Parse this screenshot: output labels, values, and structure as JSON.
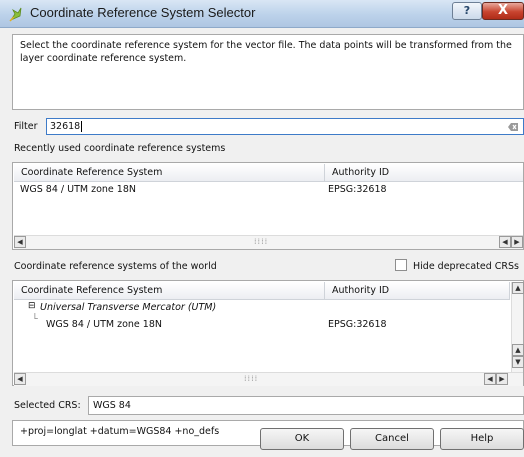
{
  "window": {
    "title": "Coordinate Reference System Selector",
    "help_glyph": "?",
    "close_glyph": "X"
  },
  "description": "Select the coordinate reference system for the vector file. The data points will be transformed from the layer coordinate reference system.",
  "filter": {
    "label": "Filter",
    "value": "32618"
  },
  "recent": {
    "label": "Recently used coordinate reference systems",
    "columns": [
      "Coordinate Reference System",
      "Authority ID"
    ],
    "rows": [
      {
        "crs": "WGS 84 / UTM zone 18N",
        "authority_id": "EPSG:32618"
      }
    ]
  },
  "world": {
    "label": "Coordinate reference systems of the world",
    "hide_deprecated_label": "Hide deprecated CRSs",
    "hide_deprecated_checked": false,
    "columns": [
      "Coordinate Reference System",
      "Authority ID"
    ],
    "group": "Universal Transverse Mercator (UTM)",
    "rows": [
      {
        "crs": "WGS 84 / UTM zone 18N",
        "authority_id": "EPSG:32618"
      }
    ]
  },
  "selected_crs": {
    "label": "Selected CRS:",
    "value": "WGS 84"
  },
  "proj_string": "+proj=longlat +datum=WGS84 +no_defs",
  "buttons": {
    "ok": "OK",
    "cancel": "Cancel",
    "help": "Help"
  }
}
